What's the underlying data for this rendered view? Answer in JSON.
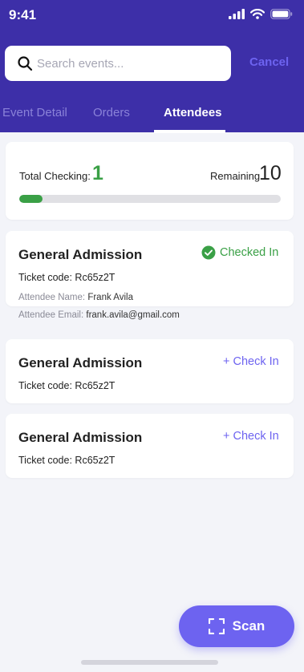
{
  "status_bar": {
    "time": "9:41"
  },
  "search": {
    "placeholder": "Search events...",
    "cancel_label": "Cancel"
  },
  "tabs": [
    {
      "label": "Event Detail",
      "active": false
    },
    {
      "label": "Orders",
      "active": false
    },
    {
      "label": "Attendees",
      "active": true
    }
  ],
  "summary": {
    "total_label": "Total Checking:",
    "total_value": "1",
    "remaining_label": "Remaining",
    "remaining_value": "10",
    "progress_fraction": 0.09
  },
  "tickets": [
    {
      "title": "General Admission",
      "code_label": "Ticket code:",
      "code": "Rc65z2T",
      "status_label": "Checked In",
      "name_label": "Attendee Name:",
      "name": "Frank Avila",
      "email_label": "Attendee Email:",
      "email": "frank.avila@gmail.com"
    },
    {
      "title": "General Admission",
      "code_label": "Ticket code:",
      "code": "Rc65z2T",
      "action_label": "+ Check In"
    },
    {
      "title": "General Admission",
      "code_label": "Ticket code:",
      "code": "Rc65z2T",
      "action_label": "+ Check In"
    }
  ],
  "scan_button": {
    "label": "Scan"
  },
  "colors": {
    "header": "#3d2fa8",
    "accent": "#6d63f0",
    "success": "#3aa046",
    "background": "#f3f4f9"
  },
  "icons": [
    "signal-icon",
    "wifi-icon",
    "battery-icon",
    "search-icon",
    "check-circle-icon",
    "scan-frame-icon"
  ]
}
